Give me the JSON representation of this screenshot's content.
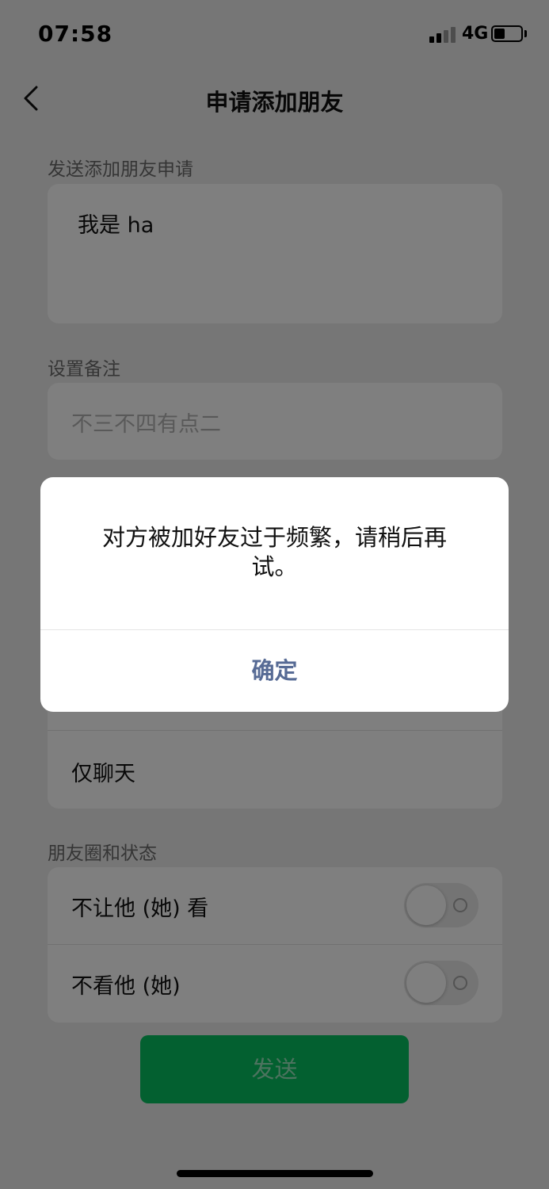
{
  "status_bar": {
    "time": "07:58",
    "network": "4G"
  },
  "nav": {
    "title": "申请添加朋友",
    "back_icon": "chevron-left-icon"
  },
  "request_section": {
    "label": "发送添加朋友申请",
    "message": "我是 ha"
  },
  "remark_section": {
    "label": "设置备注",
    "placeholder": "不三不四有点二"
  },
  "permissions": {
    "chat_only": "仅聊天"
  },
  "moments_section": {
    "label": "朋友圈和状态",
    "hide_my_moments": "不让他 (她) 看",
    "hide_their_moments": "不看他 (她)"
  },
  "send_button": "发送",
  "dialog": {
    "message": "对方被加好友过于频繁，请稍后再试。",
    "confirm": "确定"
  },
  "colors": {
    "accent_green": "#07c160",
    "link_blue": "#576b95",
    "background": "#ededed"
  }
}
